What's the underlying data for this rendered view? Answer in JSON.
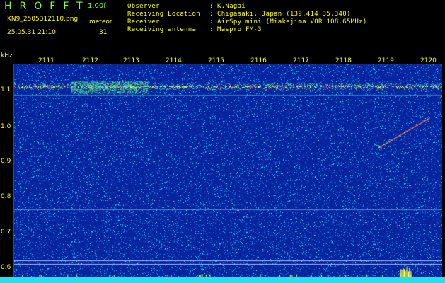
{
  "header": {
    "logo": "HROFFT",
    "version": "1.00f",
    "filename": "KN9_2505312110.png",
    "datetime": "25.05.31 21:10",
    "meteor_label": "meteor",
    "meteor_count": "31"
  },
  "info": [
    {
      "key": "Observer",
      "value": "K.Nagai"
    },
    {
      "key": "Receiving Location",
      "value": "Chigasaki, Japan (139.414 35.340)"
    },
    {
      "key": "Receiver",
      "value": "AirSpy mini (Miakejima VOR 108.65MHz)"
    },
    {
      "key": "Receiving antenna",
      "value": "Maspro FM-3"
    }
  ],
  "separator": ":",
  "axis": {
    "y_unit": "kHz",
    "x_ticks": [
      "2111",
      "2112",
      "2113",
      "2114",
      "2115",
      "2116",
      "2117",
      "2118",
      "2119",
      "2120"
    ],
    "y_ticks": [
      "1.1",
      "1.0",
      "0.9",
      "0.8",
      "0.7",
      "0.6"
    ]
  },
  "colors": {
    "background": "#08239e",
    "carrier": "#ff3a3a",
    "label_yellow": "#ffff00",
    "label_green": "#7cff3a",
    "bottom_bar": "#22e0f0"
  }
}
